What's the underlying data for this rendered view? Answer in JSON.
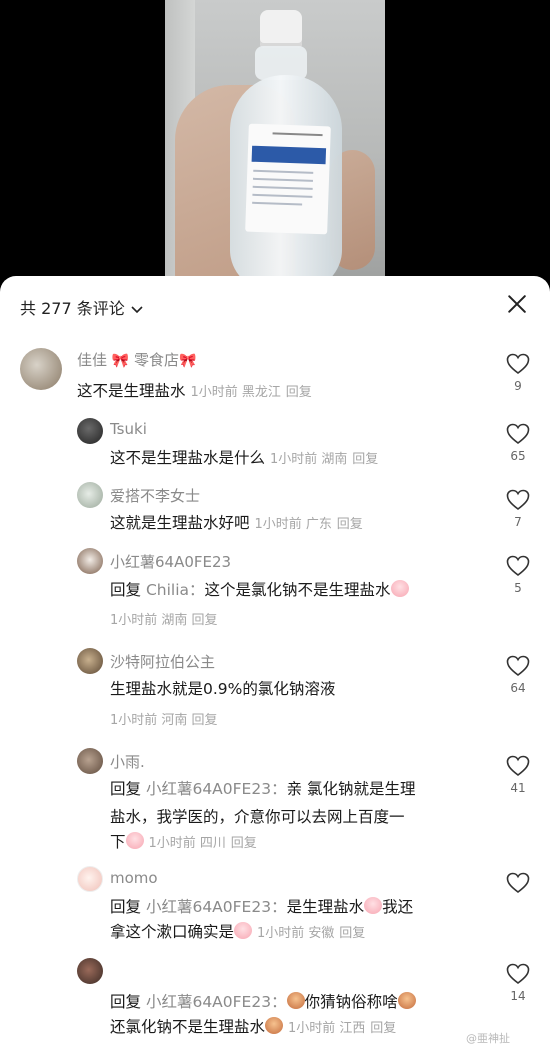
{
  "header": {
    "title": "共 277 条评论",
    "chevron_icon": "chevron-down-icon",
    "close_icon": "close-icon"
  },
  "comments": [
    {
      "name": "佳佳",
      "name_suffix": "零食店",
      "text": "这不是生理盐水",
      "meta": "1小时前 黑龙江",
      "reply": "回复",
      "likes": "9"
    },
    {
      "name": "Tsuki",
      "text": "这不是生理盐水是什么",
      "meta": "1小时前 湖南",
      "reply": "回复",
      "likes": "65"
    },
    {
      "name": "爱搭不李女士",
      "text": "这就是生理盐水好吧",
      "meta": "1小时前 广东",
      "reply": "回复",
      "likes": "7"
    },
    {
      "name": "小红薯64A0FE23",
      "reply_prefix": "回复",
      "reply_to": "Chilia：",
      "text": "这个是氯化钠不是生理盐水",
      "meta": "1小时前 湖南",
      "reply": "回复",
      "likes": "5"
    },
    {
      "name": "沙特阿拉伯公主",
      "text": "生理盐水就是0.9%的氯化钠溶液",
      "meta": "1小时前 河南",
      "reply": "回复",
      "likes": "64"
    },
    {
      "name": "小雨.",
      "reply_prefix": "回复",
      "reply_to": "小红薯64A0FE23：",
      "text_line1": "亲 氯化钠就是生理",
      "text_line2": "盐水，我学医的，介意你可以去网上百度一",
      "text_line3": "下",
      "meta": "1小时前 四川",
      "reply": "回复",
      "likes": "41"
    },
    {
      "name": "momo",
      "reply_prefix": "回复",
      "reply_to": "小红薯64A0FE23：",
      "text_line1a": "是生理盐水",
      "text_line1b": "我还",
      "text_line2": "拿这个漱口确实是",
      "meta": "1小时前 安徽",
      "reply": "回复",
      "likes": ""
    },
    {
      "name": "",
      "reply_prefix": "回复",
      "reply_to": "小红薯64A0FE23：",
      "text_line1": "你猜钠俗称啥",
      "text_line2": "还氯化钠不是生理盐水",
      "meta": "1小时前 江西",
      "reply": "回复",
      "likes": "14"
    }
  ],
  "watermark": "@亜神扯",
  "colors": {
    "name": "#8a8a8a",
    "meta": "#a6a6a6",
    "text": "#1a1a1a"
  }
}
